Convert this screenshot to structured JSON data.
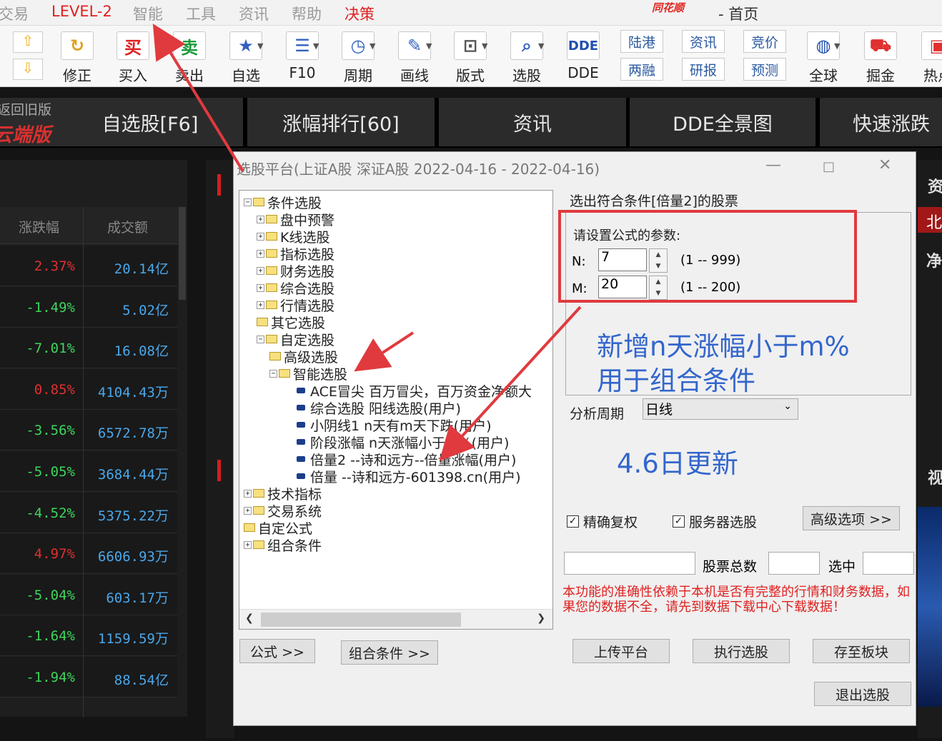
{
  "menu": {
    "items": [
      "交易",
      "LEVEL-2",
      "智能",
      "工具",
      "资讯",
      "帮助",
      "决策"
    ],
    "brand": "同花顺",
    "home": "- 首页"
  },
  "toolbar": {
    "buttons": [
      "修正",
      "买入",
      "卖出",
      "自选",
      "F10",
      "周期",
      "画线",
      "版式",
      "选股",
      "DDE",
      "全球",
      "掘金",
      "热点"
    ],
    "small": [
      "陆港",
      "资讯",
      "竞价",
      "两融",
      "研报",
      "预测"
    ],
    "buy_icon": "买",
    "sell_icon": "卖",
    "dde_icon": "DDE"
  },
  "sidebar_top": {
    "line1": "返回旧版",
    "line2": "云端版"
  },
  "tabs": [
    "自选股[F6]",
    "涨幅排行[60]",
    "资讯",
    "DDE全景图",
    "快速涨跌"
  ],
  "table": {
    "headers": [
      "涨跌幅",
      "成交额"
    ],
    "rows": [
      {
        "chg": "2.37%",
        "amt": "20.14亿",
        "dir": "up"
      },
      {
        "chg": "-1.49%",
        "amt": "5.02亿",
        "dir": "down"
      },
      {
        "chg": "-7.01%",
        "amt": "16.08亿",
        "dir": "down"
      },
      {
        "chg": "0.85%",
        "amt": "4104.43万",
        "dir": "up"
      },
      {
        "chg": "-3.56%",
        "amt": "6572.78万",
        "dir": "down"
      },
      {
        "chg": "-5.05%",
        "amt": "3684.44万",
        "dir": "down"
      },
      {
        "chg": "-4.52%",
        "amt": "5375.22万",
        "dir": "down"
      },
      {
        "chg": "4.97%",
        "amt": "6606.93万",
        "dir": "up"
      },
      {
        "chg": "-5.04%",
        "amt": "603.17万",
        "dir": "down"
      },
      {
        "chg": "-1.64%",
        "amt": "1159.59万",
        "dir": "down"
      },
      {
        "chg": "-1.94%",
        "amt": "88.54亿",
        "dir": "down"
      }
    ]
  },
  "right_strip": {
    "t1": "资",
    "t2": "北",
    "t3": "净",
    "t4": "视"
  },
  "dialog": {
    "title": "选股平台(上证A股 深证A股   2022-04-16 - 2022-04-16)",
    "tree": {
      "root": "条件选股",
      "l1": [
        "盘中预警",
        "K线选股",
        "指标选股",
        "财务选股",
        "综合选股",
        "行情选股",
        "其它选股",
        "自定选股"
      ],
      "custom": [
        "高级选股",
        "智能选股"
      ],
      "smart": [
        "ACE冒尖 百万冒尖，百万资金净额大",
        "综合选股 阳线选股(用户)",
        "小阴线1 n天有m天下跌(用户)",
        "阶段涨幅 n天涨幅小于m%(用户)",
        "倍量2 --诗和远方--倍量涨幅(用户)",
        "倍量 --诗和远方-601398.cn(用户)"
      ],
      "bottom": [
        "技术指标",
        "交易系统",
        "自定公式",
        "组合条件"
      ]
    },
    "heading": "选出符合条件[倍量2]的股票",
    "params": {
      "title": "请设置公式的参数:",
      "n_label": "N:",
      "n_value": "7",
      "n_range": "(1 -- 999)",
      "m_label": "M:",
      "m_value": "20",
      "m_range": "(1 -- 200)"
    },
    "note1": "新增n天涨幅小于m%",
    "note2": "用于组合条件",
    "note3": "4.6日更新",
    "period_label": "分析周期",
    "period_value": "日线",
    "chk_restore": "精确复权",
    "chk_server": "服务器选股",
    "advanced": "高级选项 >>",
    "total_label": "股票总数",
    "selected_label": "选中",
    "warning": "本功能的准确性依赖于本机是否有完整的行情和财务数据，如果您的数据不全，请先到数据下载中心下载数据！",
    "btn_formula": "公式 >>",
    "btn_combo": "组合条件 >>",
    "btn_upload": "上传平台",
    "btn_run": "执行选股",
    "btn_save": "存至板块",
    "btn_exit": "退出选股"
  },
  "colors": {
    "up": "#e03030",
    "down": "#3dd65c",
    "accent_red": "#e03a3e",
    "note_blue": "#3366cc"
  }
}
